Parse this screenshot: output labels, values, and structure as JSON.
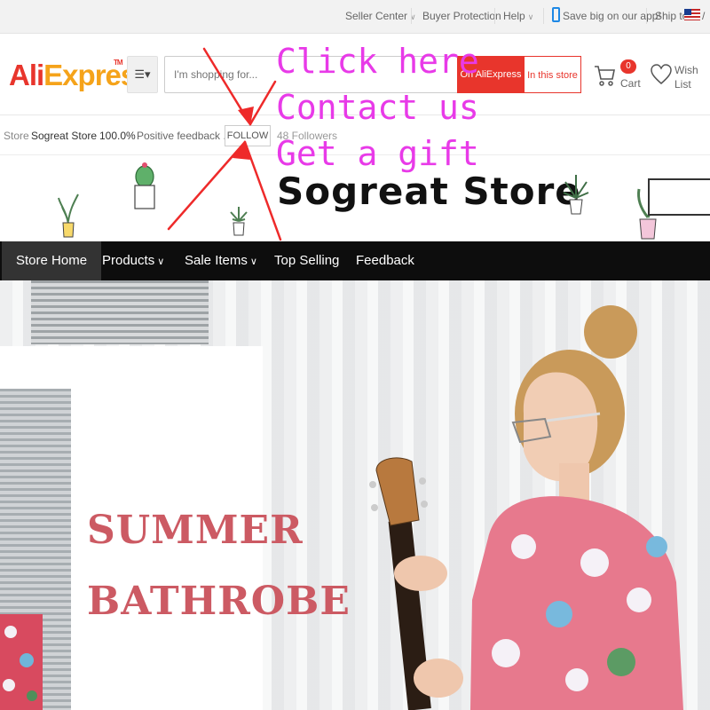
{
  "topbar": {
    "seller_center": "Seller Center",
    "buyer_protection": "Buyer Protection",
    "help": "Help",
    "app": "Save big on our app!",
    "ship_to": "Ship to",
    "slash": "/"
  },
  "header": {
    "logo_part1": "Ali",
    "logo_part2": "Express",
    "search_placeholder": "I'm shopping for...",
    "btn_aliexpress": "On AliExpress",
    "btn_store": "In this store",
    "cart_count": "0",
    "cart_label": "Cart",
    "wish_label": "Wish List"
  },
  "storebar": {
    "store_label": "Store",
    "store_name": "Sogreat Store",
    "feedback_pct": "100.0%",
    "feedback_label": "Positive feedback",
    "follow_label": "FOLLOW",
    "followers": "48 Followers"
  },
  "banner": {
    "store_title": "Sogreat Store"
  },
  "nav": {
    "items": [
      {
        "label": "Store Home"
      },
      {
        "label": "Products"
      },
      {
        "label": "Sale Items"
      },
      {
        "label": "Top Selling"
      },
      {
        "label": "Feedback"
      }
    ]
  },
  "hero": {
    "line1": "SUMMER",
    "line2": "BATHROBE"
  },
  "overlay": {
    "line1": "Click here",
    "line2": "Contact us",
    "line3": "Get a gift"
  },
  "colors": {
    "brand_red": "#e8352c",
    "brand_orange": "#f5a31a",
    "promo_magenta": "#e83ae8",
    "arrow_red": "#ee2a2a",
    "hero_text": "#cc5a63"
  }
}
